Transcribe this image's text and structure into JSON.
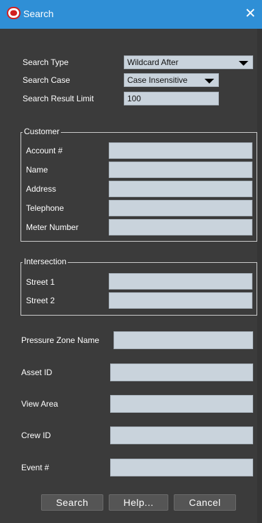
{
  "window": {
    "title": "Search",
    "close_glyph": "✕",
    "icon": "app-logo-icon",
    "titlebar_color": "#2f8fd6"
  },
  "search_options": {
    "type_label": "Search Type",
    "type_value": "Wildcard After",
    "case_label": "Search Case",
    "case_value": "Case Insensitive",
    "limit_label": "Search Result Limit",
    "limit_value": "100"
  },
  "customer": {
    "legend": "Customer",
    "account_label": "Account #",
    "account_value": "",
    "name_label": "Name",
    "name_value": "",
    "address_label": "Address",
    "address_value": "",
    "telephone_label": "Telephone",
    "telephone_value": "",
    "meter_label": "Meter Number",
    "meter_value": ""
  },
  "intersection": {
    "legend": "Intersection",
    "street1_label": "Street 1",
    "street1_value": "",
    "street2_label": "Street 2",
    "street2_value": ""
  },
  "other": {
    "pressure_label": "Pressure Zone Name",
    "pressure_value": "",
    "asset_label": "Asset ID",
    "asset_value": "",
    "view_label": "View Area",
    "view_value": "",
    "crew_label": "Crew ID",
    "crew_value": "",
    "event_label": "Event #",
    "event_value": ""
  },
  "buttons": {
    "search": "Search",
    "help": "Help...",
    "cancel": "Cancel"
  }
}
